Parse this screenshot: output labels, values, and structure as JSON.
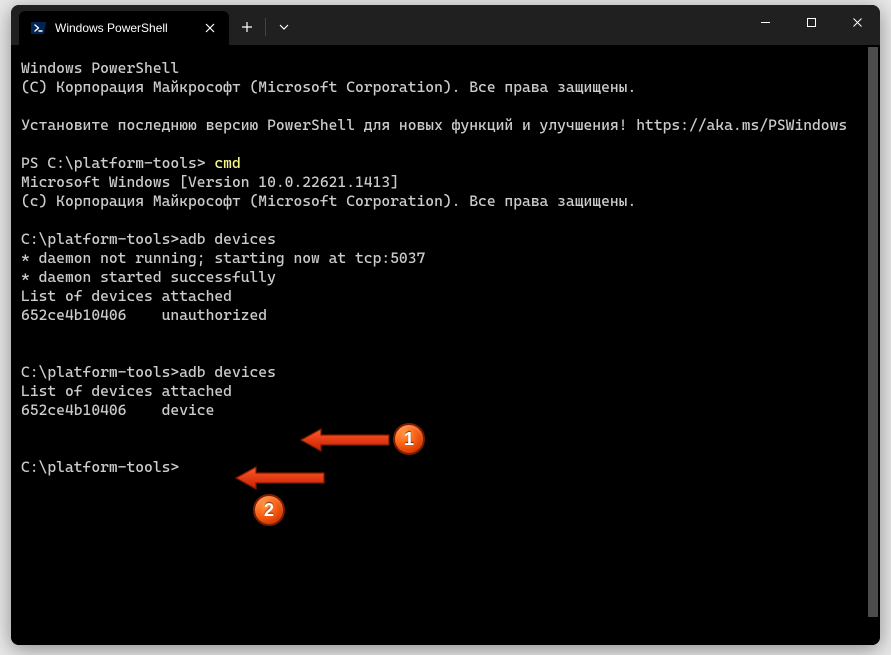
{
  "window": {
    "tab_title": "Windows PowerShell"
  },
  "terminal": {
    "l01": "Windows PowerShell",
    "l02": "(C) Корпорация Майкрософт (Microsoft Corporation). Все права защищены.",
    "l03": "",
    "l04": "Установите последнюю версию PowerShell для новых функций и улучшения! https://aka.ms/PSWindows",
    "l05": "",
    "p1_prompt": "PS C:\\platform-tools> ",
    "p1_cmd": "cmd",
    "l07": "Microsoft Windows [Version 10.0.22621.1413]",
    "l08": "(c) Корпорация Майкрософт (Microsoft Corporation). Все права защищены.",
    "l09": "",
    "l10": "C:\\platform-tools>adb devices",
    "l11": "* daemon not running; starting now at tcp:5037",
    "l12": "* daemon started successfully",
    "l13": "List of devices attached",
    "l14": "652ce4b10406    unauthorized",
    "l15": "",
    "l16": "",
    "l17": "C:\\platform-tools>adb devices",
    "l18": "List of devices attached",
    "l19": "652ce4b10406    device",
    "l20": "",
    "l21": "",
    "l22": "C:\\platform-tools>"
  },
  "callouts": {
    "b1": "1",
    "b2": "2"
  }
}
